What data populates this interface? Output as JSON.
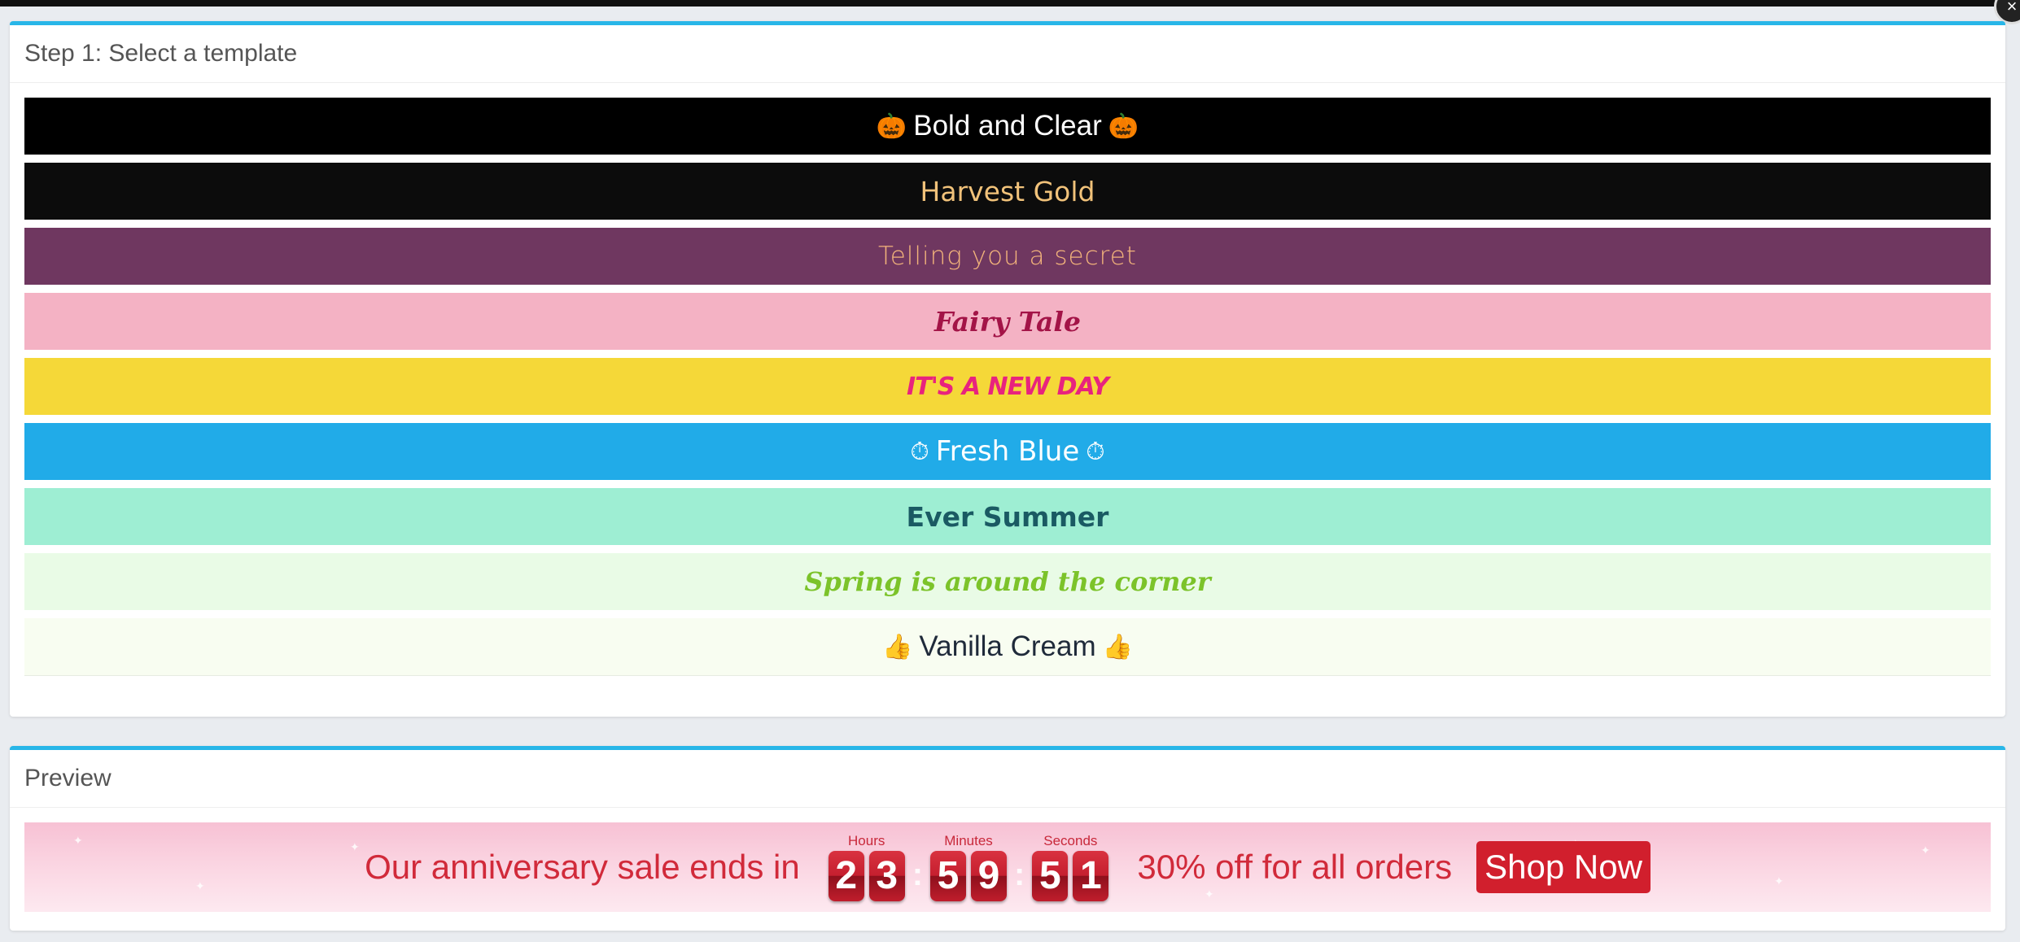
{
  "templates_panel": {
    "title": "Step 1: Select a template",
    "items": [
      {
        "label": "Bold and Clear",
        "emoji_left": "🎃",
        "emoji_right": "🎃"
      },
      {
        "label": "Harvest Gold",
        "emoji_left": "",
        "emoji_right": ""
      },
      {
        "label": "Telling you a secret",
        "emoji_left": "",
        "emoji_right": ""
      },
      {
        "label": "Fairy Tale",
        "emoji_left": "",
        "emoji_right": ""
      },
      {
        "label": "IT'S A NEW DAY",
        "emoji_left": "",
        "emoji_right": ""
      },
      {
        "label": "Fresh Blue",
        "emoji_left": "⏱",
        "emoji_right": "⏱"
      },
      {
        "label": "Ever Summer",
        "emoji_left": "",
        "emoji_right": ""
      },
      {
        "label": "Spring is around the corner",
        "emoji_left": "",
        "emoji_right": ""
      },
      {
        "label": "Vanilla Cream",
        "emoji_left": "👍",
        "emoji_right": "👍"
      }
    ]
  },
  "preview_panel": {
    "title": "Preview",
    "message": "Our anniversary sale ends in",
    "timer": {
      "hours_label": "Hours",
      "minutes_label": "Minutes",
      "seconds_label": "Seconds",
      "hours": [
        "2",
        "3"
      ],
      "minutes": [
        "5",
        "9"
      ],
      "seconds": [
        "5",
        "1"
      ],
      "separator": ":"
    },
    "offer": "30% off for all orders",
    "button_label": "Shop Now"
  },
  "colors": {
    "accent": "#28b6e8",
    "preview_text": "#d12a3a",
    "button_bg": "#d11f2d"
  },
  "icons": {
    "close": "close-icon"
  }
}
